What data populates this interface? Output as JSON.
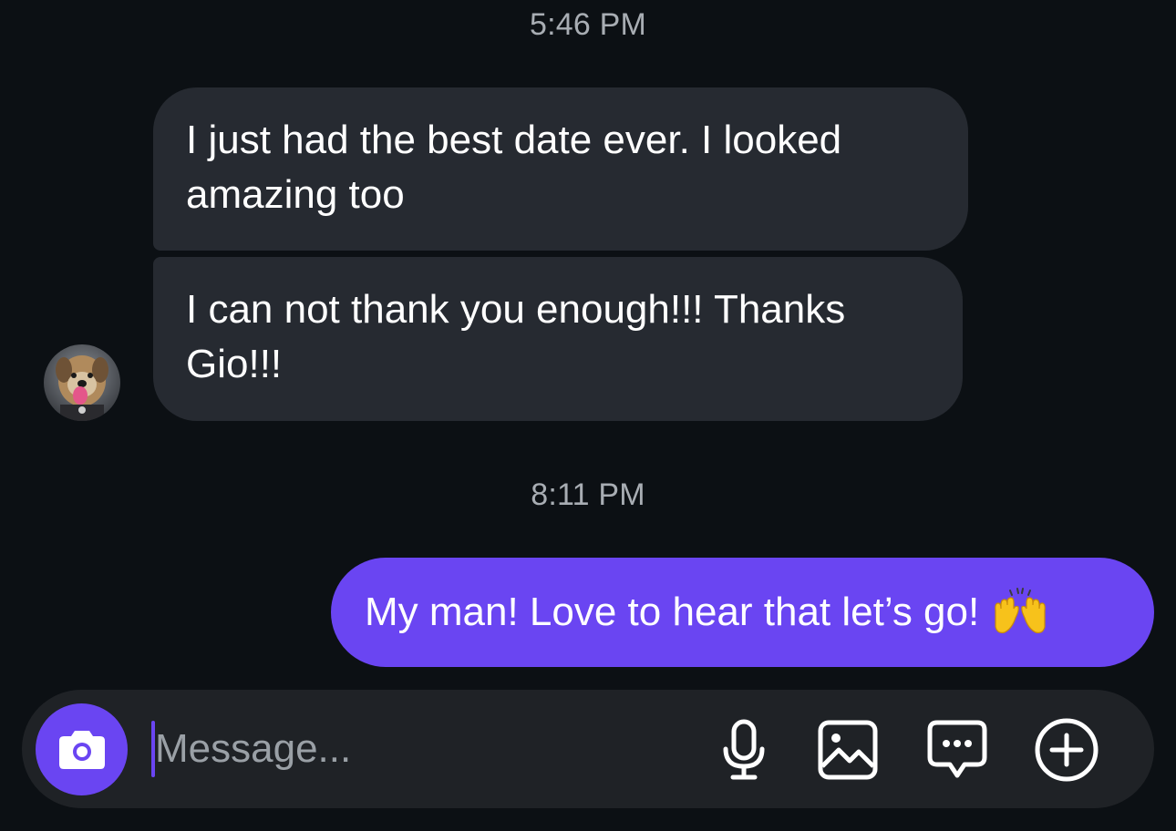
{
  "conversation": {
    "timestamps": [
      "5:46 PM",
      "8:11 PM"
    ],
    "incoming": [
      "I just had the best date ever.  I looked amazing too",
      "I can not thank you enough!!! Thanks Gio!!!"
    ],
    "outgoing": [
      "My man! Love to hear that let’s go!"
    ],
    "outgoing_emoji": "raising-hands-emoji"
  },
  "composer": {
    "placeholder": "Message...",
    "icons": [
      "camera-icon",
      "microphone-icon",
      "gallery-icon",
      "sticker-icon",
      "plus-icon"
    ]
  },
  "colors": {
    "background": "#0c1014",
    "incoming_bubble": "#262a31",
    "outgoing_bubble": "#6a45f2",
    "accent": "#6a45f2",
    "composer": "#1f2226"
  }
}
